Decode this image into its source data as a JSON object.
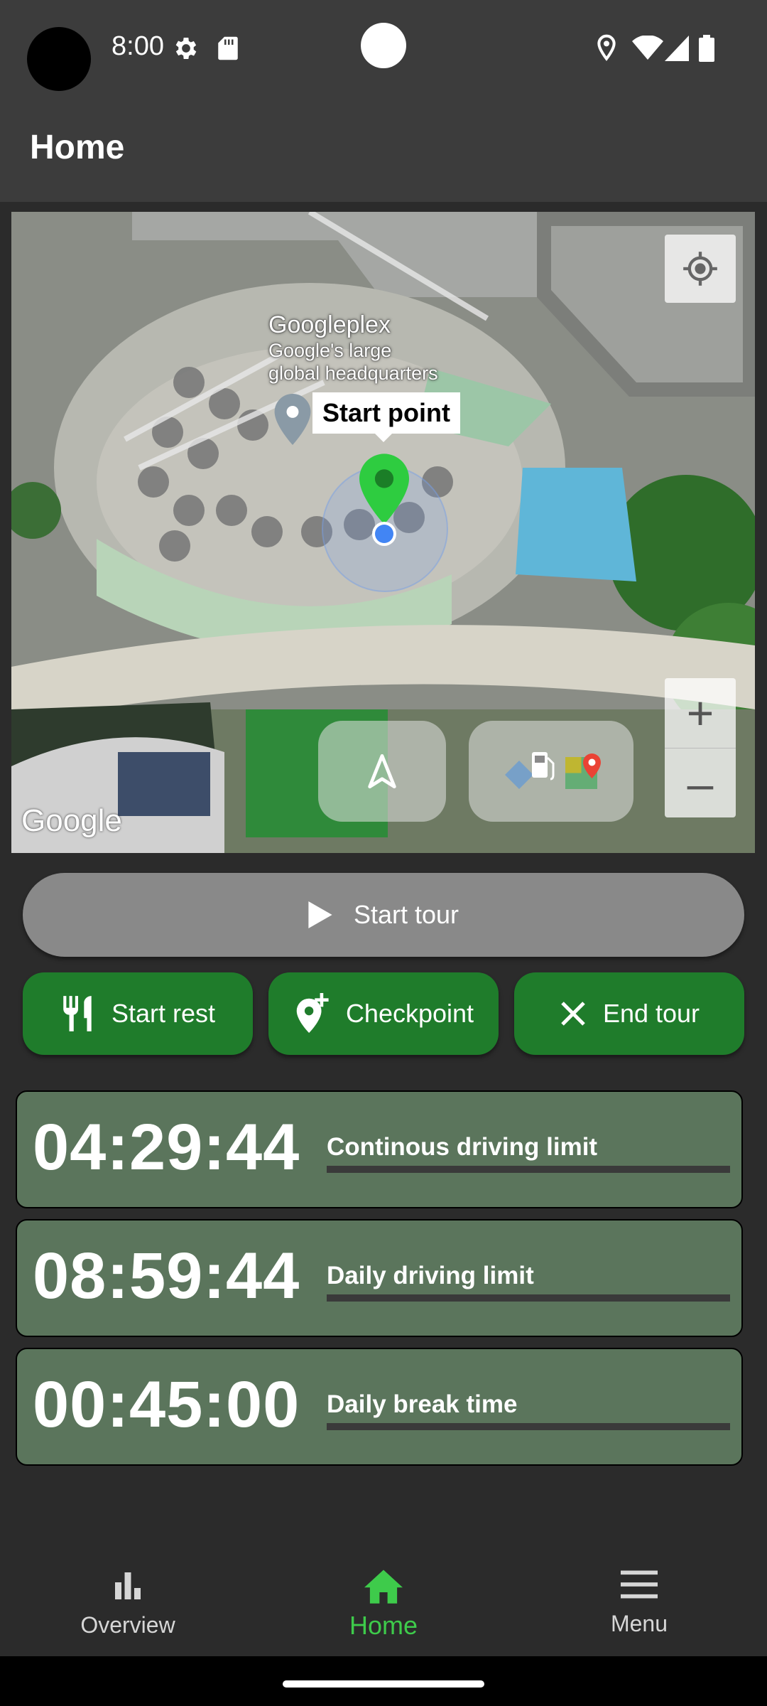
{
  "status_bar": {
    "time": "8:00"
  },
  "app_bar": {
    "title": "Home"
  },
  "map": {
    "place_name": "Googleplex",
    "place_desc_line1": "Google's large",
    "place_desc_line2": "global headquarters",
    "marker_callout": "Start point",
    "zoom_in": "+",
    "zoom_out": "–",
    "attribution": "Google"
  },
  "actions": {
    "start_tour": "Start tour",
    "start_rest": "Start rest",
    "checkpoint": "Checkpoint",
    "end_tour": "End tour"
  },
  "timers": [
    {
      "time": "04:29:44",
      "label": "Continous driving limit"
    },
    {
      "time": "08:59:44",
      "label": "Daily driving limit"
    },
    {
      "time": "00:45:00",
      "label": "Daily break time"
    }
  ],
  "bottom_nav": [
    {
      "label": "Overview",
      "icon": "bar-chart-icon",
      "active": false
    },
    {
      "label": "Home",
      "icon": "home-icon",
      "active": true
    },
    {
      "label": "Menu",
      "icon": "hamburger-menu-icon",
      "active": false
    }
  ],
  "colors": {
    "accent_green": "#1f7c2b",
    "active_nav": "#3ecb4b",
    "card_bg": "#5b755c",
    "marker_green": "#2ecc40"
  }
}
